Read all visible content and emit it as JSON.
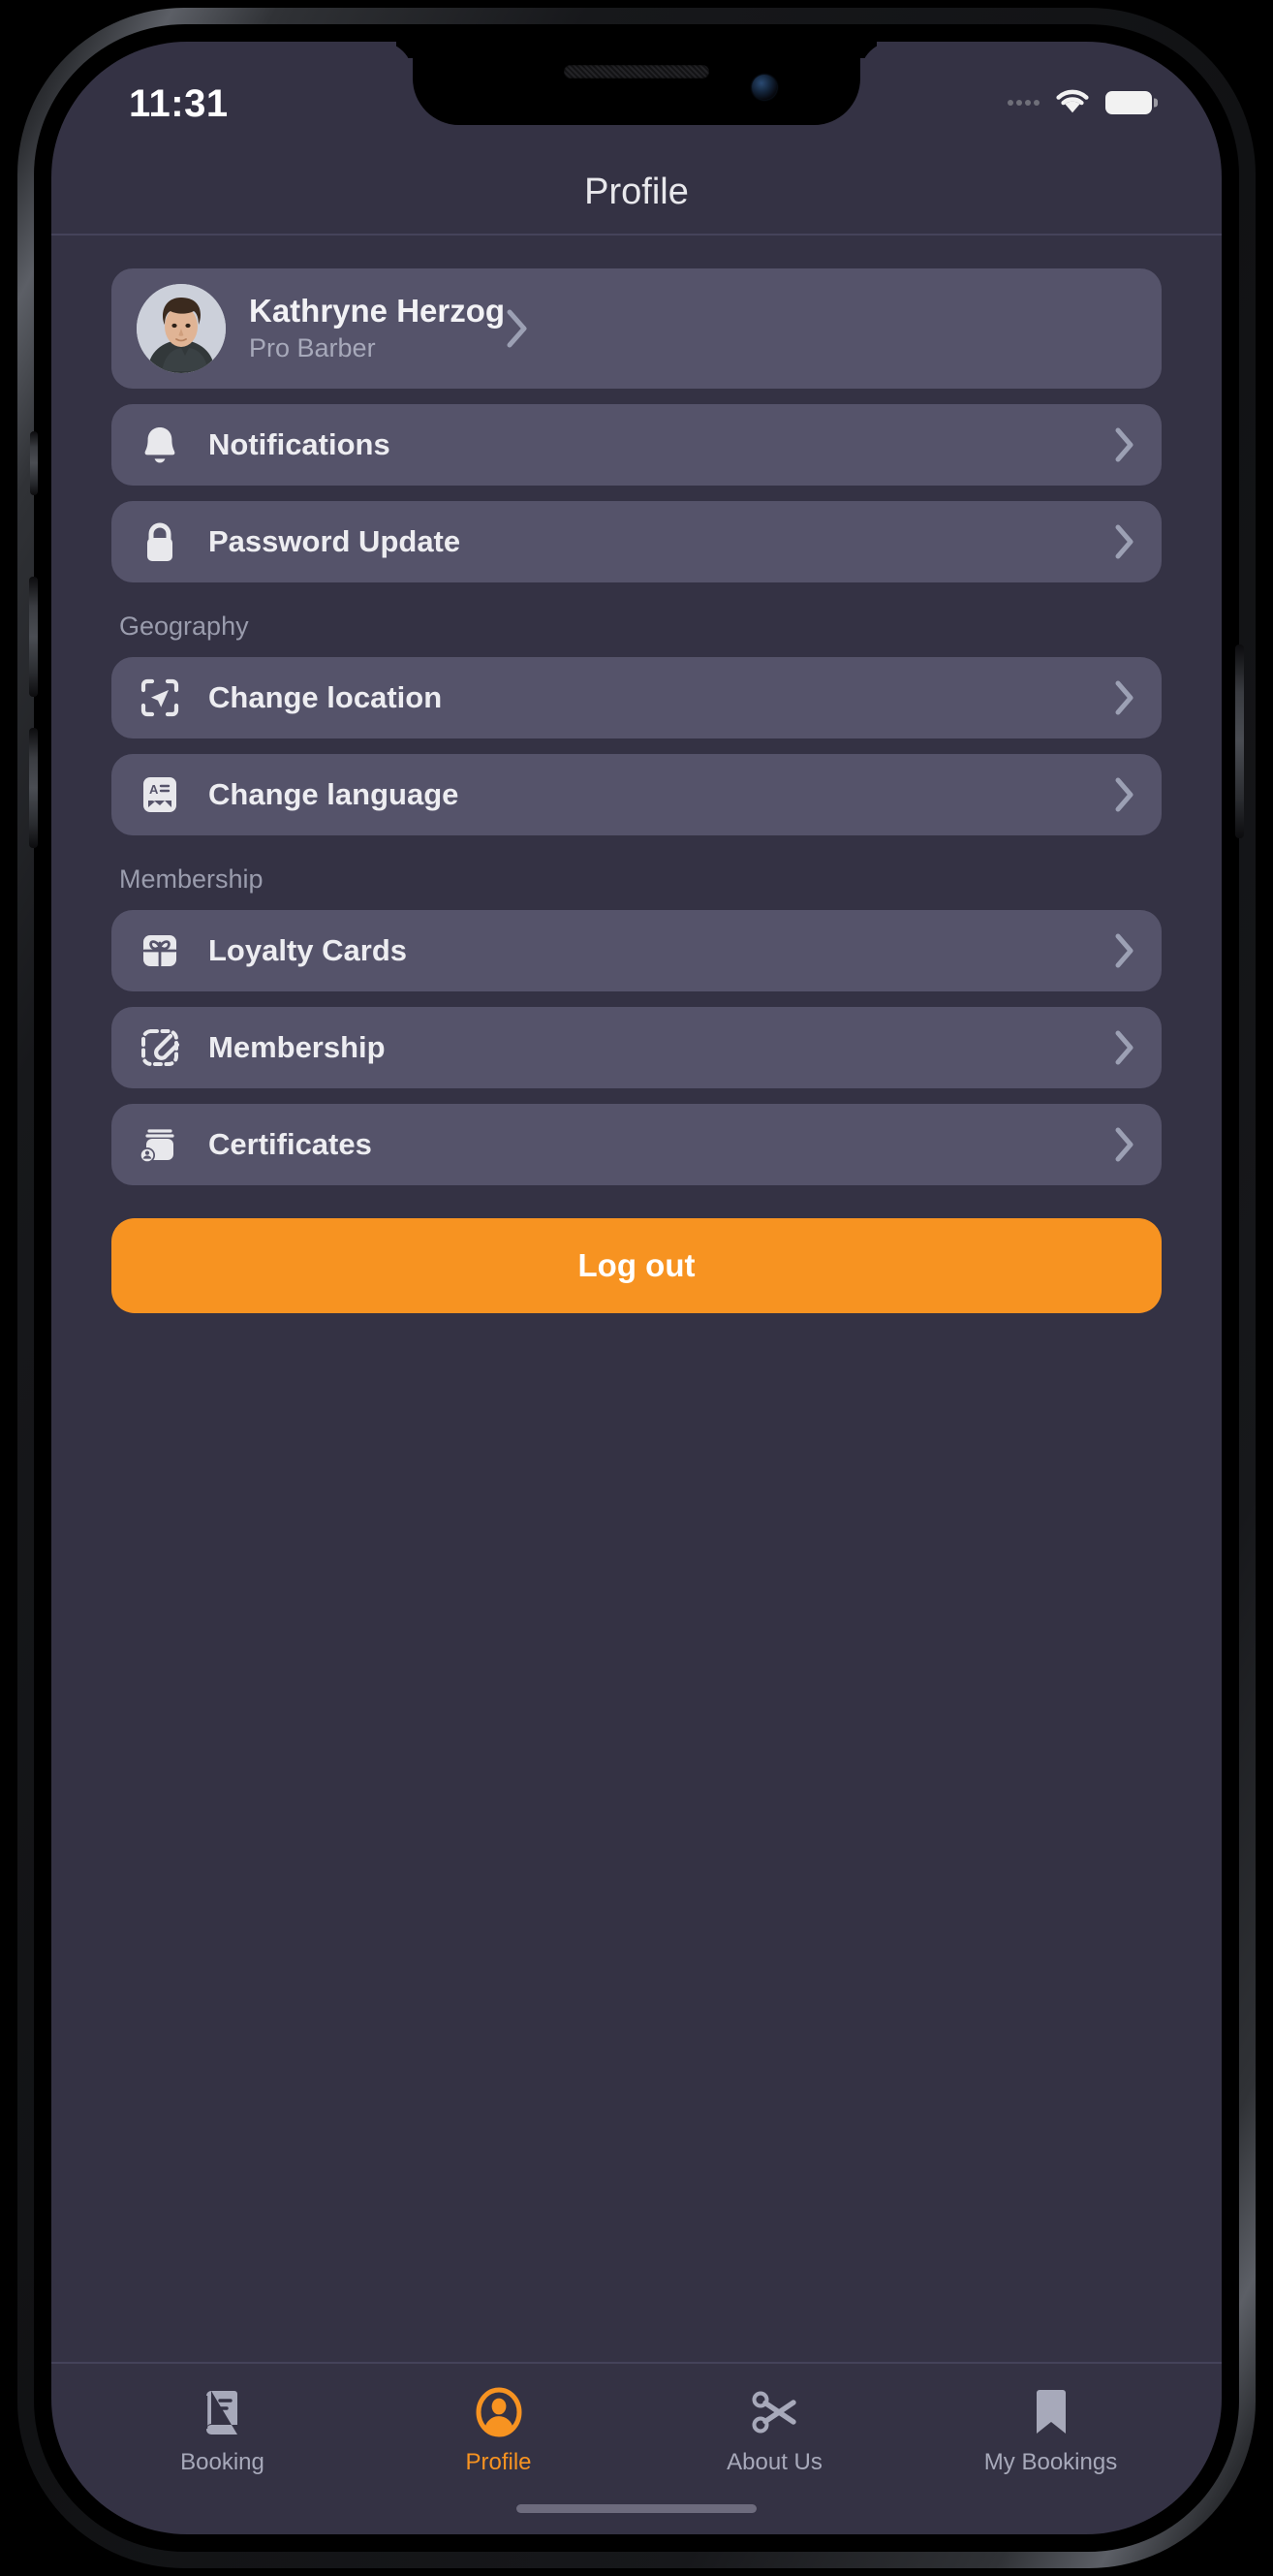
{
  "status_bar": {
    "time": "11:31",
    "signal_icon": "signal-dots-icon",
    "wifi_icon": "wifi-icon",
    "battery_icon": "battery-full-icon"
  },
  "header": {
    "title": "Profile"
  },
  "profile": {
    "name": "Kathryne Herzog",
    "role": "Pro Barber",
    "avatar_icon": "avatar-photo",
    "chevron_icon": "chevron-right-icon"
  },
  "menu": {
    "primary_items": [
      {
        "label": "Notifications",
        "icon": "bell-icon",
        "chevron": "chevron-right-icon"
      },
      {
        "label": "Password Update",
        "icon": "lock-icon",
        "chevron": "chevron-right-icon"
      }
    ],
    "sections": [
      {
        "title": "Geography",
        "items": [
          {
            "label": "Change location",
            "icon": "location-scan-icon",
            "chevron": "chevron-right-icon"
          },
          {
            "label": "Change language",
            "icon": "language-card-icon",
            "chevron": "chevron-right-icon"
          }
        ]
      },
      {
        "title": "Membership",
        "items": [
          {
            "label": "Loyalty Cards",
            "icon": "gift-icon",
            "chevron": "chevron-right-icon"
          },
          {
            "label": "Membership",
            "icon": "dashed-attachment-icon",
            "chevron": "chevron-right-icon"
          },
          {
            "label": "Certificates",
            "icon": "certificate-stack-icon",
            "chevron": "chevron-right-icon"
          }
        ]
      }
    ]
  },
  "logout": {
    "label": "Log out"
  },
  "tab_bar": {
    "items": [
      {
        "label": "Booking",
        "icon": "book-icon",
        "active": false
      },
      {
        "label": "Profile",
        "icon": "user-circle-icon",
        "active": true
      },
      {
        "label": "About Us",
        "icon": "scissors-icon",
        "active": false
      },
      {
        "label": "My Bookings",
        "icon": "bookmark-icon",
        "active": false
      }
    ]
  },
  "colors": {
    "accent": "#f79321",
    "screen_background": "#343244",
    "card_background": "#55536a",
    "primary_text": "#ededf1",
    "secondary_text": "#a7a9ba",
    "chevron": "#9ca0b4"
  }
}
